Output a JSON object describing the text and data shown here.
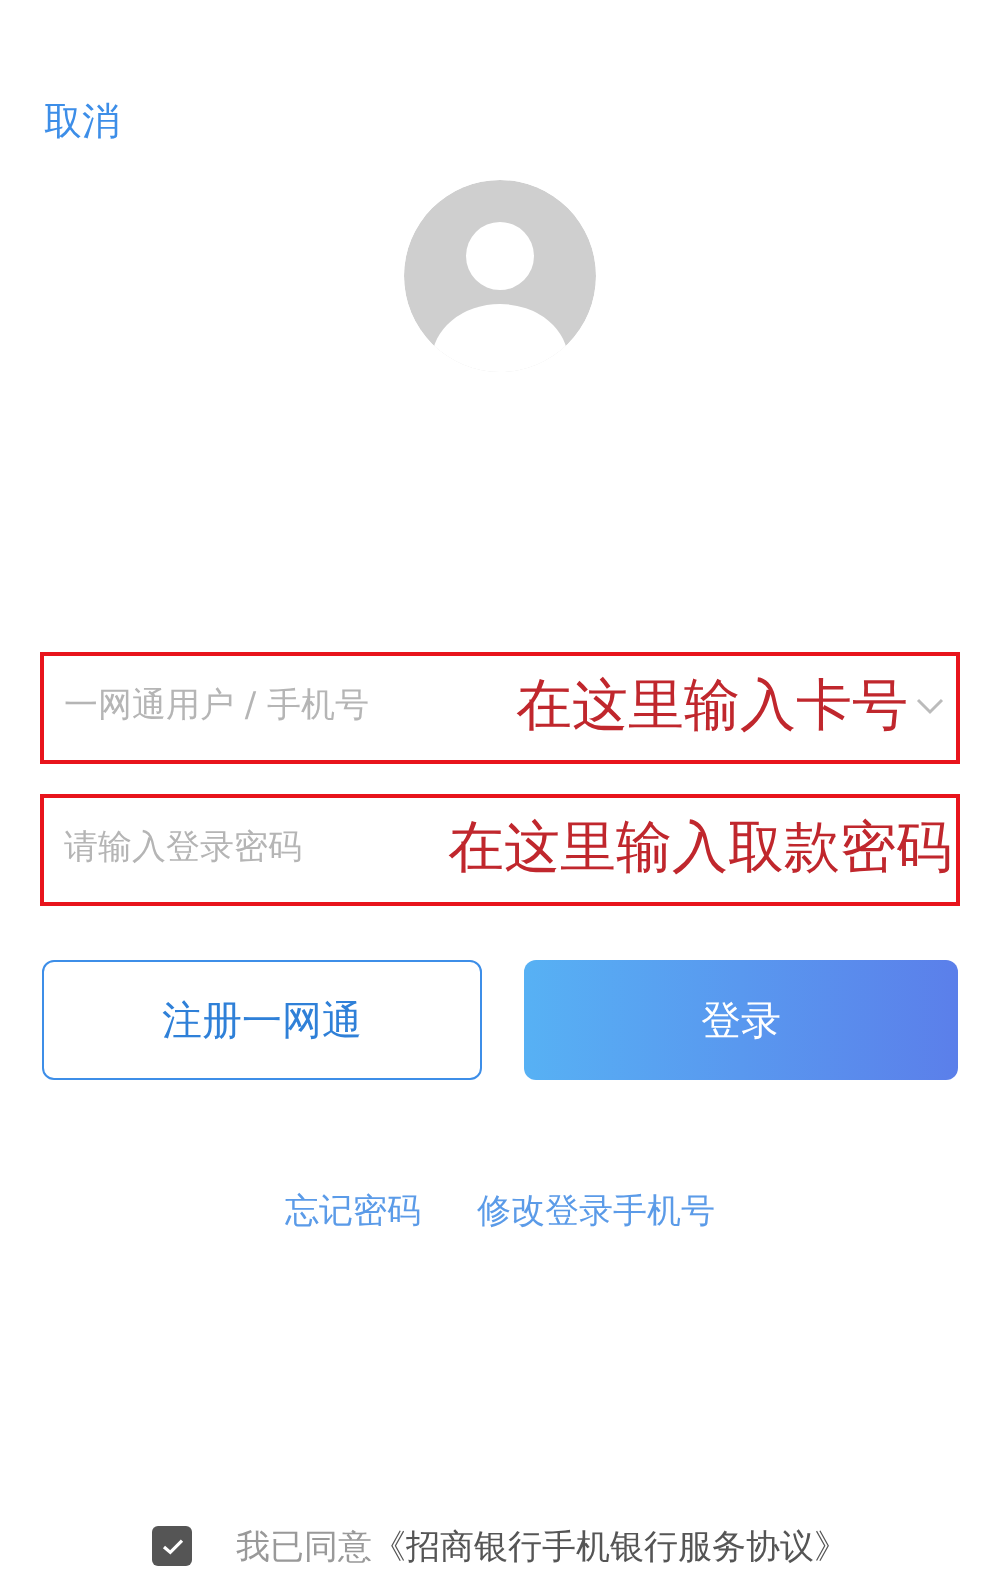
{
  "cancel": "取消",
  "fields": [
    {
      "kind": "account",
      "placeholder": "一网通用户 / 手机号",
      "dropdown": true,
      "annotation": "在这里输入卡号"
    },
    {
      "kind": "password",
      "placeholder": "请输入登录密码",
      "dropdown": false,
      "annotation": "在这里输入取款密码"
    }
  ],
  "buttons": [
    {
      "kind": "outline",
      "label": "注册一网通"
    },
    {
      "kind": "primary",
      "label": "登录"
    }
  ],
  "links": [
    "忘记密码",
    "修改登录手机号"
  ],
  "agreement": {
    "checked": true,
    "label": "我已同意",
    "link": "《招商银行手机银行服务协议》"
  }
}
